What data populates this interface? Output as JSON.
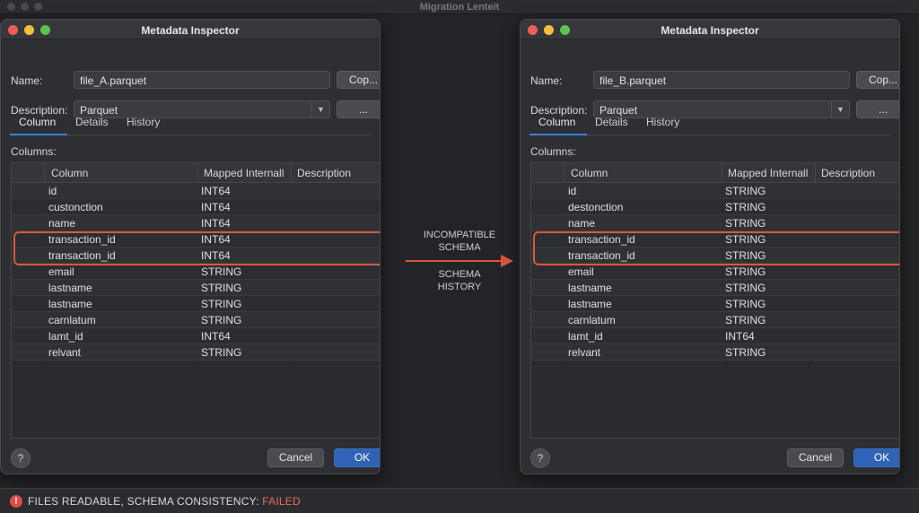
{
  "app": {
    "title": "Migration Lenteit"
  },
  "dialogs": [
    {
      "title": "Metadata Inspector",
      "name_label": "Name:",
      "name_value": "file_A.parquet",
      "copy_label": "Cop...",
      "description_label": "Description:",
      "description_value": "Parquet",
      "more_label": "...",
      "tabs": [
        "Column",
        "Details",
        "History"
      ],
      "columns_label": "Columns:",
      "headers": [
        "Column",
        "Mapped Internall",
        "Description"
      ],
      "rows": [
        {
          "name": "id",
          "type": "INT64",
          "desc": ""
        },
        {
          "name": "custonction",
          "type": "INT64",
          "desc": ""
        },
        {
          "name": "name",
          "type": "INT64",
          "desc": ""
        },
        {
          "name": "transaction_id",
          "type": "INT64",
          "desc": ""
        },
        {
          "name": "transaction_id",
          "type": "INT64",
          "desc": ""
        },
        {
          "name": "email",
          "type": "STRING",
          "desc": ""
        },
        {
          "name": "lastname",
          "type": "STRING",
          "desc": ""
        },
        {
          "name": "lastname",
          "type": "STRING",
          "desc": ""
        },
        {
          "name": "carnlatum",
          "type": "STRING",
          "desc": ""
        },
        {
          "name": "lamt_id",
          "type": "INT64",
          "desc": ""
        },
        {
          "name": "relvant",
          "type": "STRING",
          "desc": ""
        }
      ],
      "help_label": "?",
      "cancel_label": "Cancel",
      "ok_label": "OK"
    },
    {
      "title": "Metadata Inspector",
      "name_label": "Name:",
      "name_value": "file_B.parquet",
      "copy_label": "Cop...",
      "description_label": "Description:",
      "description_value": "Parquet",
      "more_label": "...",
      "tabs": [
        "Column",
        "Details",
        "History"
      ],
      "columns_label": "Columns:",
      "headers": [
        "Column",
        "Mapped Internall",
        "Description"
      ],
      "rows": [
        {
          "name": "id",
          "type": "STRING",
          "desc": ""
        },
        {
          "name": "destonction",
          "type": "STRING",
          "desc": ""
        },
        {
          "name": "name",
          "type": "STRING",
          "desc": ""
        },
        {
          "name": "transaction_id",
          "type": "STRING",
          "desc": ""
        },
        {
          "name": "transaction_id",
          "type": "STRING",
          "desc": ""
        },
        {
          "name": "email",
          "type": "STRING",
          "desc": ""
        },
        {
          "name": "lastname",
          "type": "STRING",
          "desc": ""
        },
        {
          "name": "lastname",
          "type": "STRING",
          "desc": ""
        },
        {
          "name": "carnlatum",
          "type": "STRING",
          "desc": ""
        },
        {
          "name": "lamt_id",
          "type": "INT64",
          "desc": ""
        },
        {
          "name": "relvant",
          "type": "STRING",
          "desc": ""
        }
      ],
      "help_label": "?",
      "cancel_label": "Cancel",
      "ok_label": "OK"
    }
  ],
  "comparison": {
    "label_1a": "INCOMPATIBLE",
    "label_1b": "SCHEMA",
    "label_2a": "SCHEMA",
    "label_2b": "HISTORY",
    "arrow_color": "#d9573e"
  },
  "status": {
    "icon": "error-icon",
    "icon_glyph": "!",
    "prefix": "FILES READABLE, SCHEMA CONSISTENCY: ",
    "result": "FAILED"
  }
}
